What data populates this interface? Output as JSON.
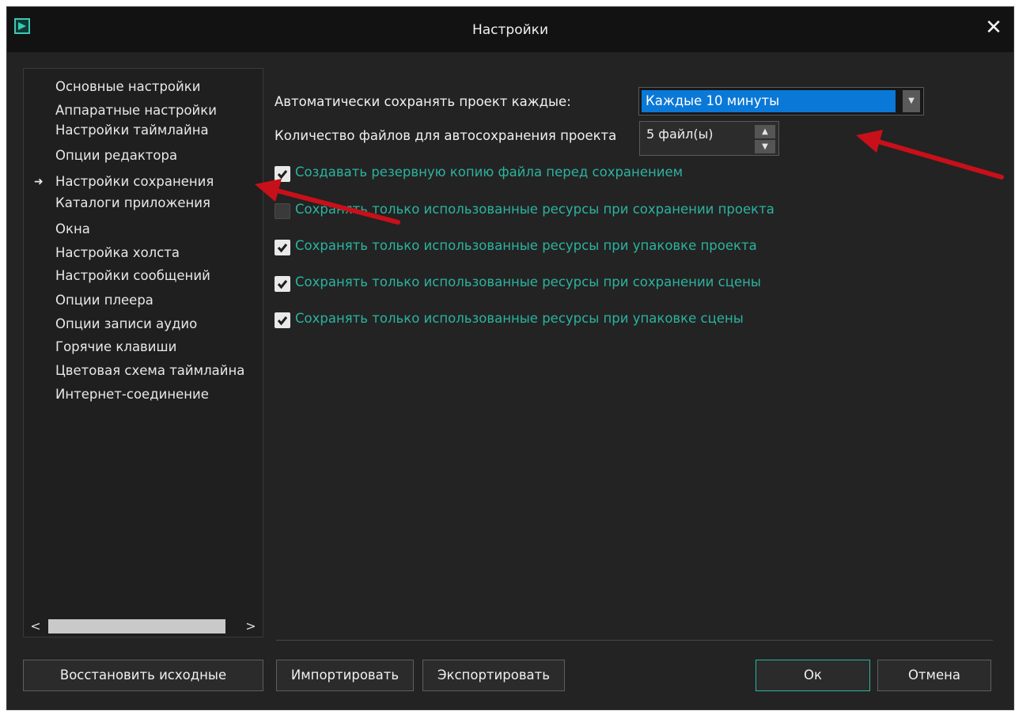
{
  "window": {
    "title": "Настройки"
  },
  "sidebar": {
    "items": [
      {
        "label": "Основные настройки",
        "selected": false
      },
      {
        "label": "Аппаратные настройки",
        "selected": false
      },
      {
        "label": "Настройки таймлайна",
        "selected": false
      },
      {
        "label": "Опции редактора",
        "selected": false
      },
      {
        "label": "Настройки сохранения",
        "selected": true
      },
      {
        "label": "Каталоги приложения",
        "selected": false
      },
      {
        "label": "Окна",
        "selected": false
      },
      {
        "label": "Настройка холста",
        "selected": false
      },
      {
        "label": "Настройки сообщений",
        "selected": false
      },
      {
        "label": "Опции плеера",
        "selected": false
      },
      {
        "label": "Опции записи аудио",
        "selected": false
      },
      {
        "label": "Горячие клавиши",
        "selected": false
      },
      {
        "label": "Цветовая схема таймлайна",
        "selected": false
      },
      {
        "label": "Интернет-соединение",
        "selected": false
      }
    ]
  },
  "main": {
    "autosave_label": "Автоматически сохранять проект каждые:",
    "autosave_value": "Каждые 10 минуты",
    "files_label": "Количество файлов для автосохранения проекта",
    "files_value": "5 файл(ы)",
    "checkboxes": [
      {
        "label": "Создавать резервную копию файла перед сохранением",
        "checked": true
      },
      {
        "label": "Сохранять только использованные ресурсы при сохранении проекта",
        "checked": false
      },
      {
        "label": "Сохранять только использованные ресурсы при упаковке проекта",
        "checked": true
      },
      {
        "label": "Сохранять только использованные ресурсы при сохранении сцены",
        "checked": true
      },
      {
        "label": "Сохранять только использованные ресурсы при упаковке сцены",
        "checked": true
      }
    ]
  },
  "buttons": {
    "restore": "Восстановить исходные",
    "import": "Импортировать",
    "export": "Экспортировать",
    "ok": "Ок",
    "cancel": "Отмена"
  },
  "colors": {
    "accent": "#2bb3a0",
    "selection": "#0a78d7",
    "annotation_arrow": "#c8101a",
    "background": "#232323"
  },
  "icons": {
    "app": "app-logo-icon",
    "close": "close-icon",
    "selected_item": "arrow-right-icon",
    "dropdown": "chevron-down-icon",
    "spin_up": "triangle-up-icon",
    "spin_down": "triangle-down-icon",
    "check": "checkmark-icon"
  }
}
